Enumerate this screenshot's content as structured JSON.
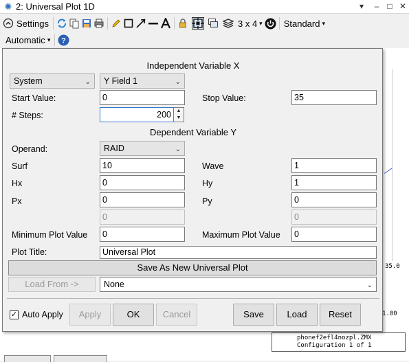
{
  "window": {
    "title": "2: Universal Plot 1D",
    "controls": [
      "▾",
      "–",
      "□",
      "✕"
    ]
  },
  "toolbar": {
    "settings_label": "Settings",
    "layout_label": "3 x 4",
    "style_label": "Standard",
    "scale_label": "Automatic"
  },
  "dialog": {
    "independent_title": "Independent Variable X",
    "dependent_title": "Dependent Variable Y",
    "x_category": "System",
    "x_parameter": "Y Field 1",
    "start_label": "Start Value:",
    "start_value": "0",
    "stop_label": "Stop Value:",
    "stop_value": "35",
    "steps_label": "# Steps:",
    "steps_value": "200",
    "operand_label": "Operand:",
    "operand_value": "RAID",
    "surf_label": "Surf",
    "surf_value": "10",
    "wave_label": "Wave",
    "wave_value": "1",
    "hx_label": "Hx",
    "hx_value": "0",
    "hy_label": "Hy",
    "hy_value": "1",
    "px_label": "Px",
    "px_value": "0",
    "py_label": "Py",
    "py_value": "0",
    "extra_left_value": "0",
    "extra_right_value": "0",
    "min_label": "Minimum Plot Value",
    "min_value": "0",
    "max_label": "Maximum Plot Value",
    "max_value": "0",
    "plot_title_label": "Plot Title:",
    "plot_title_value": "Universal Plot",
    "save_as_new_label": "Save As New Universal Plot",
    "load_from_label": "Load From ->",
    "load_from_value": "None",
    "auto_apply_label": "Auto Apply",
    "auto_apply_checked": true,
    "apply_label": "Apply",
    "ok_label": "OK",
    "cancel_label": "Cancel",
    "save_label": "Save",
    "load_label": "Load",
    "reset_label": "Reset"
  },
  "plot": {
    "tick_right": "35.0",
    "tick_bottom": "1.00",
    "file_name": "phonef2efl4nozpl.ZMX",
    "configuration": "Configuration 1 of 1",
    "line_color": "#3a55d0"
  }
}
